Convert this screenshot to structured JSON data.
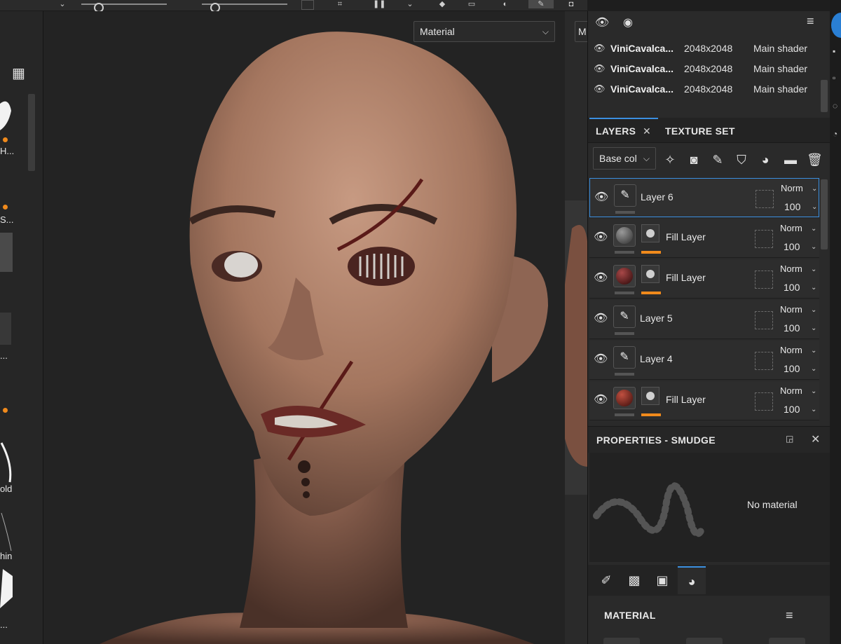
{
  "viewport": {
    "shading_mode": "Material",
    "secondary_dropdown_letter": "M"
  },
  "shelf": {
    "labels": [
      "H...",
      "S...",
      "...",
      "old",
      "hin",
      "..."
    ]
  },
  "texture_sets": [
    {
      "name": "ViniCavalca...",
      "resolution": "2048x2048",
      "shader": "Main shader"
    },
    {
      "name": "ViniCavalca...",
      "resolution": "2048x2048",
      "shader": "Main shader"
    },
    {
      "name": "ViniCavalca...",
      "resolution": "2048x2048",
      "shader": "Main shader"
    }
  ],
  "tabs": {
    "layers": "LAYERS",
    "texture_set_settings": "TEXTURE SET SETTINGS"
  },
  "channel_dropdown": "Base col",
  "layers": [
    {
      "name": "Layer 6",
      "type": "paint",
      "mode": "Norm",
      "opacity": "100",
      "selected": true,
      "thumb_color": ""
    },
    {
      "name": "Fill Layer",
      "type": "fill",
      "mode": "Norm",
      "opacity": "100",
      "selected": false,
      "thumb_color": "#5a5a5a"
    },
    {
      "name": "Fill Layer",
      "type": "fill",
      "mode": "Norm",
      "opacity": "100",
      "selected": false,
      "thumb_color": "#5a1414"
    },
    {
      "name": "Layer 5",
      "type": "paint",
      "mode": "Norm",
      "opacity": "100",
      "selected": false,
      "thumb_color": ""
    },
    {
      "name": "Layer 4",
      "type": "paint",
      "mode": "Norm",
      "opacity": "100",
      "selected": false,
      "thumb_color": ""
    },
    {
      "name": "Fill Layer",
      "type": "fill",
      "mode": "Norm",
      "opacity": "100",
      "selected": false,
      "thumb_color": "#6e1a16"
    }
  ],
  "properties": {
    "title": "PROPERTIES - SMUDGE",
    "material_status": "No material",
    "section_title": "MATERIAL"
  },
  "colors": {
    "accent_blue": "#3b8fe0",
    "accent_orange": "#f08a1c",
    "panel_bg": "#2a2a2a"
  }
}
